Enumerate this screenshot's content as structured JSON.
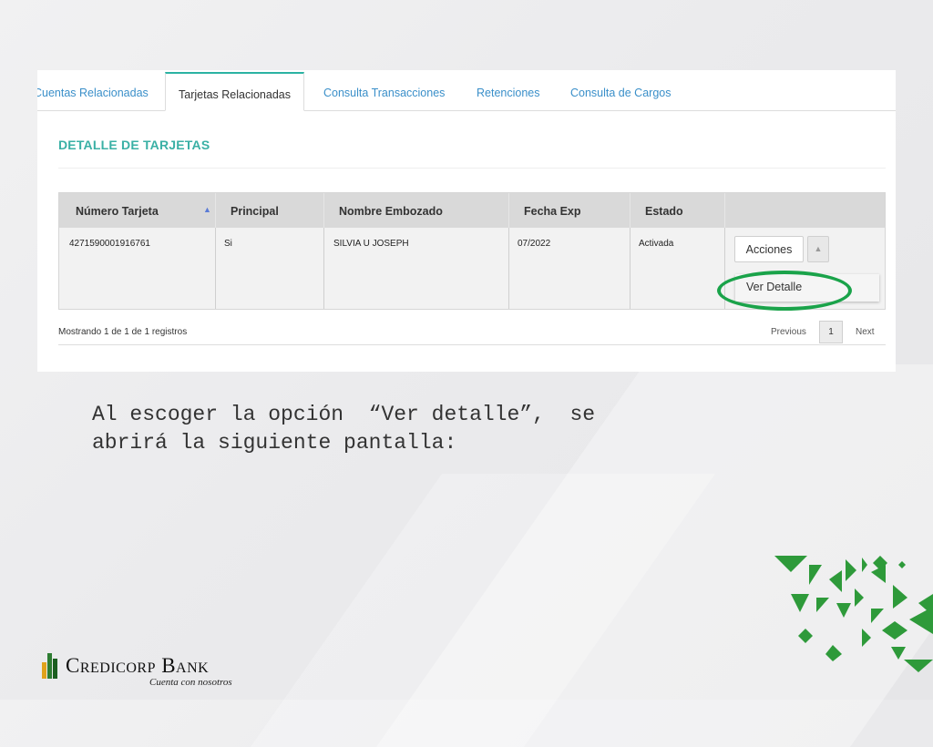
{
  "tabs": [
    {
      "label": "Cuentas Relacionadas",
      "active": false
    },
    {
      "label": "Tarjetas Relacionadas",
      "active": true
    },
    {
      "label": "Consulta Transacciones",
      "active": false
    },
    {
      "label": "Retenciones",
      "active": false
    },
    {
      "label": "Consulta de Cargos",
      "active": false
    }
  ],
  "section_title": "DETALLE DE TARJETAS",
  "table": {
    "headers": [
      "Número Tarjeta",
      "Principal",
      "Nombre Embozado",
      "Fecha Exp",
      "Estado"
    ],
    "rows": [
      {
        "numero": "4271590001916761",
        "principal": "Si",
        "nombre": "SILVIA U JOSEPH",
        "fecha": "07/2022",
        "estado": "Activada"
      }
    ],
    "action_button": "Acciones",
    "dropdown_item": "Ver Detalle"
  },
  "pagination": {
    "info": "Mostrando 1 de 1 de 1 registros",
    "previous": "Previous",
    "page": "1",
    "next": "Next"
  },
  "caption": {
    "line1": "Al escoger la opción  “Ver detalle”,  se",
    "line2": "abrirá la siguiente pantalla:"
  },
  "brand": {
    "name": "Credicorp Bank",
    "tagline": "Cuenta con nosotros"
  },
  "colors": {
    "accent_teal": "#3ab0a5",
    "link_blue": "#3a8fc9",
    "highlight_green": "#1aa34a",
    "deco_green": "#2e9a3a"
  }
}
